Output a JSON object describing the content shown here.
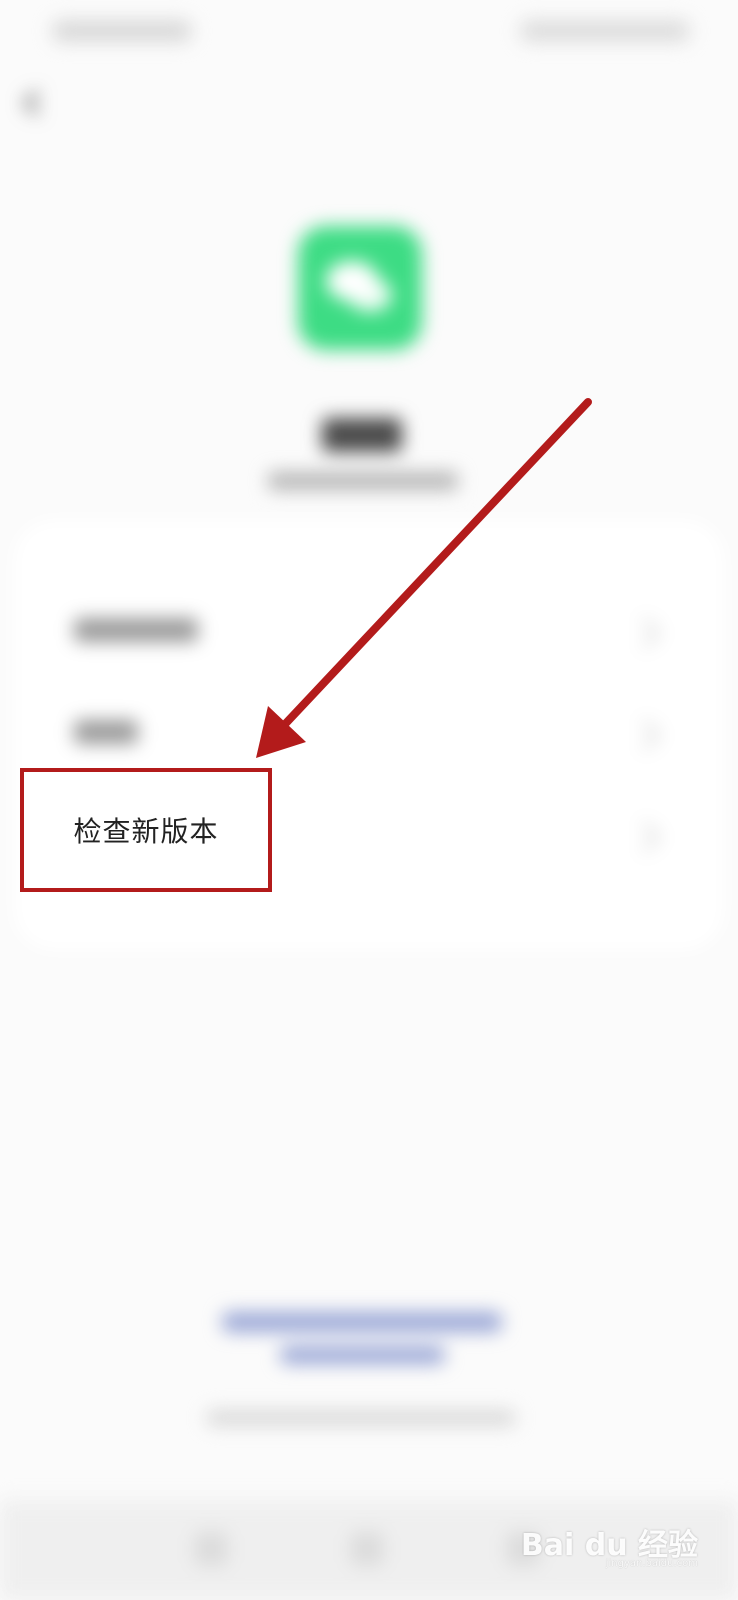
{
  "highlight": {
    "label": "检查新版本"
  },
  "annotation": {
    "color": "#b31b1b"
  },
  "app": {
    "icon_color": "#3ddc84",
    "icon": "chat-bubbles-icon"
  },
  "watermark": {
    "brand": "Bai du 经验",
    "sub": "jingyan.baidu.com"
  }
}
